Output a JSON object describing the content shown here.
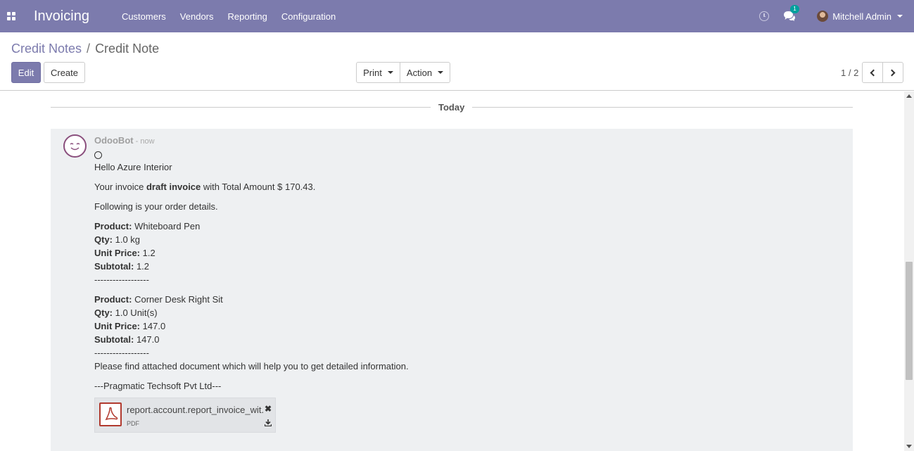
{
  "navbar": {
    "brand": "Invoicing",
    "menu": [
      {
        "label": "Customers"
      },
      {
        "label": "Vendors"
      },
      {
        "label": "Reporting"
      },
      {
        "label": "Configuration"
      }
    ],
    "messages_badge": "1",
    "user_name": "Mitchell Admin",
    "accent_color": "#7c7bad"
  },
  "breadcrumb": {
    "parent": "Credit Notes",
    "separator": "/",
    "current": "Credit Note"
  },
  "buttons": {
    "edit": "Edit",
    "create": "Create",
    "print": "Print",
    "action": "Action"
  },
  "pager": {
    "value": "1 / 2"
  },
  "chatter": {
    "date_separator": "Today",
    "message": {
      "author": "OdooBot",
      "separator": " - ",
      "time": "now",
      "greeting": "Hello Azure Interior",
      "invoice_prefix": "Your invoice ",
      "invoice_name": "draft invoice",
      "invoice_suffix": " with Total Amount $ 170.43.",
      "intro": "Following is your order details.",
      "labels": {
        "product": "Product:",
        "qty": "Qty:",
        "unit_price": "Unit Price:",
        "subtotal": "Subtotal:"
      },
      "products": [
        {
          "product": "Whiteboard Pen",
          "qty": "1.0 kg",
          "unit_price": "1.2",
          "subtotal": "1.2"
        },
        {
          "product": "Corner Desk Right Sit",
          "qty": "1.0 Unit(s)",
          "unit_price": "147.0",
          "subtotal": "147.0"
        }
      ],
      "divider": "------------------",
      "closing": "Please find attached document which will help you to get detailed information.",
      "signature": "---Pragmatic Techsoft Pvt Ltd---",
      "attachment": {
        "name": "report.account.report_invoice_wit...",
        "type": "PDF"
      }
    }
  }
}
